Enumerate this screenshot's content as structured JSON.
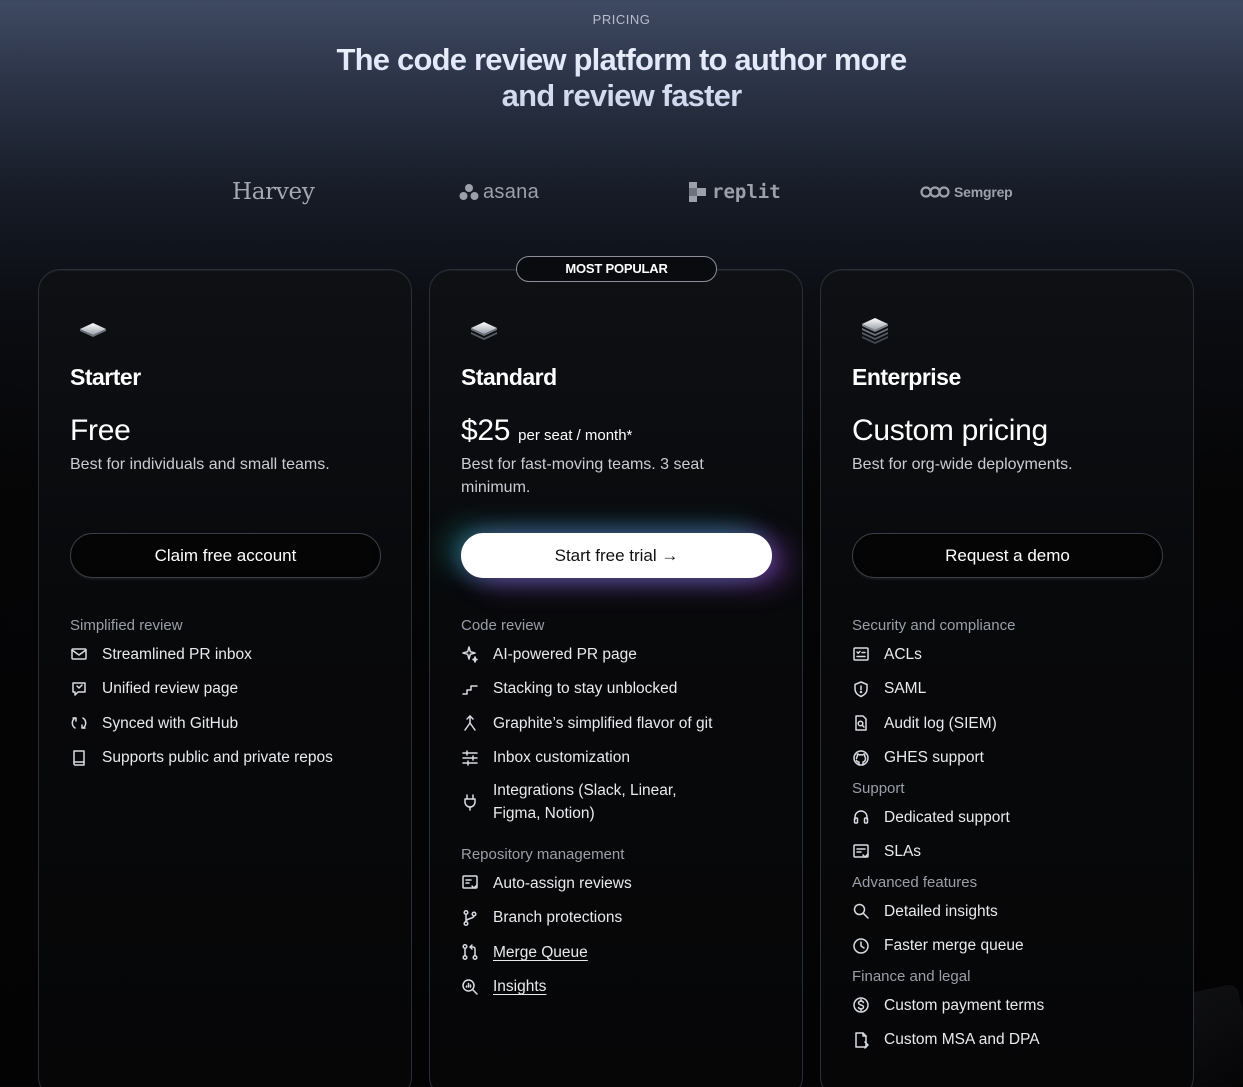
{
  "header": {
    "eyebrow": "PRICING",
    "title": "The code review platform to author more and review faster"
  },
  "logos": [
    {
      "name": "Harvey",
      "icon": "harvey-logo"
    },
    {
      "name": "asana",
      "icon": "asana-logo"
    },
    {
      "name": "replit",
      "icon": "replit-logo"
    },
    {
      "name": "Semgrep",
      "icon": "semgrep-logo"
    }
  ],
  "badge": "MOST POPULAR",
  "plans": [
    {
      "name": "Starter",
      "price": "Free",
      "price_unit": "",
      "description": "Best for individuals and small teams.",
      "cta": "Claim free account",
      "sections": [
        {
          "label": "Simplified review",
          "items": [
            {
              "text": "Streamlined PR inbox",
              "icon": "mail-icon"
            },
            {
              "text": "Unified review page",
              "icon": "review-icon"
            },
            {
              "text": "Synced with GitHub",
              "icon": "sync-icon"
            },
            {
              "text": "Supports public and private repos",
              "icon": "book-icon"
            }
          ]
        }
      ]
    },
    {
      "name": "Standard",
      "price": "$25",
      "price_unit": "per seat / month*",
      "description": "Best for fast-moving teams. 3 seat minimum.",
      "cta": "Start free trial →",
      "sections": [
        {
          "label": "Code review",
          "items": [
            {
              "text": "AI-powered PR page",
              "icon": "sparkle-icon"
            },
            {
              "text": "Stacking to stay unblocked",
              "icon": "stairs-icon"
            },
            {
              "text": "Graphite’s simplified flavor of git",
              "icon": "git-fork-icon"
            },
            {
              "text": "Inbox customization",
              "icon": "sliders-icon"
            },
            {
              "text": "Integrations (Slack, Linear, Figma, Notion)",
              "icon": "plug-icon"
            }
          ]
        },
        {
          "label": "Repository management",
          "items": [
            {
              "text": "Auto-assign reviews",
              "icon": "checklist-icon"
            },
            {
              "text": "Branch protections",
              "icon": "branch-icon"
            },
            {
              "text": "Merge Queue",
              "icon": "merge-icon",
              "link": true
            },
            {
              "text": "Insights",
              "icon": "insights-icon",
              "link": true
            }
          ]
        }
      ]
    },
    {
      "name": "Enterprise",
      "price": "Custom pricing",
      "price_unit": "",
      "description": "Best for org-wide deployments.",
      "cta": "Request a demo",
      "sections": [
        {
          "label": "Security and compliance",
          "items": [
            {
              "text": "ACLs",
              "icon": "acl-icon"
            },
            {
              "text": "SAML",
              "icon": "shield-icon"
            },
            {
              "text": "Audit log (SIEM)",
              "icon": "audit-icon"
            },
            {
              "text": "GHES support",
              "icon": "github-icon"
            }
          ]
        },
        {
          "label": "Support",
          "items": [
            {
              "text": "Dedicated support",
              "icon": "headset-icon"
            },
            {
              "text": "SLAs",
              "icon": "sla-icon"
            }
          ]
        },
        {
          "label": "Advanced features",
          "items": [
            {
              "text": "Detailed insights",
              "icon": "search-icon"
            },
            {
              "text": "Faster merge queue",
              "icon": "clock-icon"
            }
          ]
        },
        {
          "label": "Finance and legal",
          "items": [
            {
              "text": "Custom payment terms",
              "icon": "dollar-icon"
            },
            {
              "text": "Custom MSA and DPA",
              "icon": "document-icon"
            }
          ]
        }
      ]
    }
  ]
}
